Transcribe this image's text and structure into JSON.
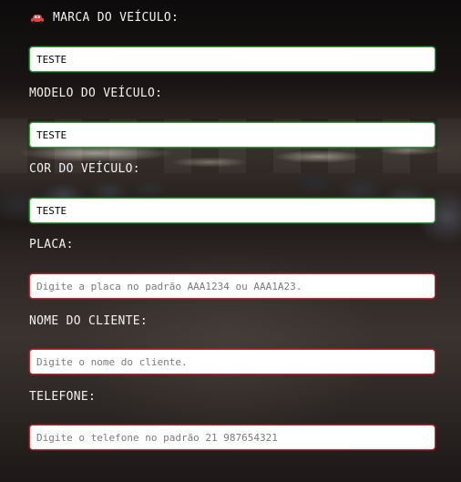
{
  "form": {
    "brand": {
      "label": "MARCA DO VEÍCULO:",
      "value": "TESTE",
      "icon": "car-icon"
    },
    "model": {
      "label": "MODELO DO VEÍCULO:",
      "value": "TESTE"
    },
    "color": {
      "label": "COR DO VEÍCULO:",
      "value": "TESTE"
    },
    "plate": {
      "label": "PLACA:",
      "value": "",
      "placeholder": "Digite a placa no padrão AAA1234 ou AAA1A23."
    },
    "client_name": {
      "label": "NOME DO CLIENTE:",
      "value": "",
      "placeholder": "Digite o nome do cliente."
    },
    "phone": {
      "label": "TELEFONE:",
      "value": "",
      "placeholder": "Digite o telefone no padrão 21 987654321"
    }
  },
  "colors": {
    "valid_border": "#2f9e3a",
    "invalid_border": "#c9222a",
    "icon_color": "#e0443e"
  }
}
